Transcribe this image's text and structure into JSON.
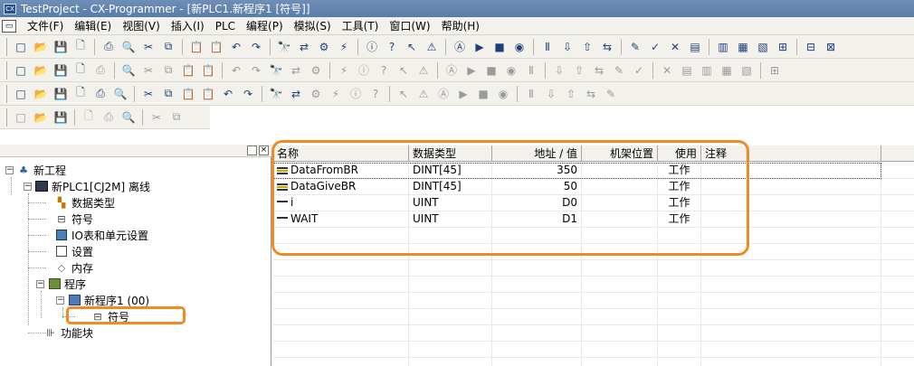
{
  "window": {
    "title": "TestProject - CX-Programmer - [新PLC1.新程序1 [符号]]",
    "icon": "cx-programmer-icon"
  },
  "menu": [
    {
      "label": "文件(F)"
    },
    {
      "label": "编辑(E)"
    },
    {
      "label": "视图(V)"
    },
    {
      "label": "插入(I)"
    },
    {
      "label": "PLC"
    },
    {
      "label": "编程(P)"
    },
    {
      "label": "模拟(S)"
    },
    {
      "label": "工具(T)"
    },
    {
      "label": "窗口(W)"
    },
    {
      "label": "帮助(H)"
    }
  ],
  "toolbars": {
    "row1": [
      "new-icon",
      "open-icon",
      "save-icon",
      "preview-icon",
      "print-icon",
      "print-preview-icon",
      "cut-icon",
      "copy-icon",
      "paste-icon",
      "paste-special-icon",
      "undo-icon",
      "redo-icon",
      "find-icon",
      "replace-icon",
      "cross-ref-icon",
      "address-icon",
      "info-icon",
      "help-icon",
      "context-help-icon",
      "warning-icon",
      "compile-icon",
      "run-icon",
      "stop-icon",
      "monitor-icon",
      "pause-icon",
      "transfer-to-icon",
      "transfer-from-icon",
      "compare-icon",
      "online-edit-icon",
      "online-edit-send-icon",
      "online-edit-cancel-icon",
      "io-table-icon",
      "io-table2-icon",
      "io-table3-icon",
      "io-table4-icon",
      "fb-icon",
      "fb2-icon",
      "io-comment-icon"
    ],
    "row2": [
      "zoom-icon",
      "zoom-fit-icon",
      "zoom-in-icon",
      "zoom-out-icon",
      "grid-icon",
      "comment-icon",
      "ladder-icon",
      "mnemonic-icon",
      "list-icon",
      "symbol-table-icon",
      "select-icon",
      "contact-no-icon",
      "contact-nc-icon",
      "contact-or-icon",
      "contact-ornc-icon",
      "vline-icon",
      "hline-icon",
      "coil-icon",
      "coil-nc-icon",
      "instr-icon",
      "instr2-icon",
      "instr3-icon",
      "line-connect-icon",
      "line-delete-icon",
      "compile-program-icon",
      "online-icon",
      "monitor-diff-icon",
      "set-icon",
      "reset-icon",
      "force-icon",
      "force-cancel-icon",
      "segment-icon",
      "toolbar-a-icon",
      "toolbar-b-icon",
      "toolbar-c-icon",
      "toolbar-d-icon"
    ],
    "row3": [
      "window-project-icon",
      "window-output-icon",
      "window-watch-icon",
      "window-address-icon",
      "window-ref-icon",
      "window-properties-icon",
      "find-fb-icon",
      "fb-library-icon",
      "cpu-bus-icon",
      "memory-card-icon",
      "error-log-icon",
      "time-chart-icon",
      "data-trace-icon",
      "trace2-icon",
      "transfer-icon",
      "transfer2-icon",
      "transfer3-icon",
      "sim-icon",
      "sim-monitor-icon",
      "step-icon",
      "step-run-icon",
      "sim-play-icon",
      "sim-stop-icon",
      "sim-pause-icon",
      "sim-step-in-icon",
      "sim-step-over-icon",
      "sim-step-out-icon",
      "sim-fast-icon",
      "sim-end-icon"
    ],
    "row4": [
      "indent-icon",
      "outdent-icon",
      "align-left-icon",
      "align-right-icon",
      "bookmark-icon",
      "bookmark-next-icon",
      "bookmark-prev-icon",
      "bookmark-clear-icon"
    ]
  },
  "tree": {
    "project": "新工程",
    "plc": "新PLC1[CJ2M] 离线",
    "items": {
      "data_types": "数据类型",
      "symbols": "符号",
      "io_table": "IO表和单元设置",
      "settings": "设置",
      "memory": "内存",
      "programs": "程序",
      "program1": "新程序1 (00)",
      "program1_symbols": "符号",
      "function_blocks": "功能块"
    }
  },
  "table": {
    "headers": [
      "名称",
      "数据类型",
      "地址 / 值",
      "机架位置",
      "使用",
      "注释"
    ],
    "rows": [
      {
        "name": "DataFromBR",
        "type": "DINT[45]",
        "address": "350",
        "rack": "",
        "usage": "工作",
        "comment": "",
        "icon": "array-symbol-icon"
      },
      {
        "name": "DataGiveBR",
        "type": "DINT[45]",
        "address": "50",
        "rack": "",
        "usage": "工作",
        "comment": "",
        "icon": "array-symbol-icon"
      },
      {
        "name": "i",
        "type": "UINT",
        "address": "D0",
        "rack": "",
        "usage": "工作",
        "comment": "",
        "icon": "symbol-icon"
      },
      {
        "name": "WAIT",
        "type": "UINT",
        "address": "D1",
        "rack": "",
        "usage": "工作",
        "comment": "",
        "icon": "symbol-icon"
      }
    ]
  },
  "colors": {
    "highlight": "#f08a22",
    "titlebar": "#5a7ca8"
  }
}
